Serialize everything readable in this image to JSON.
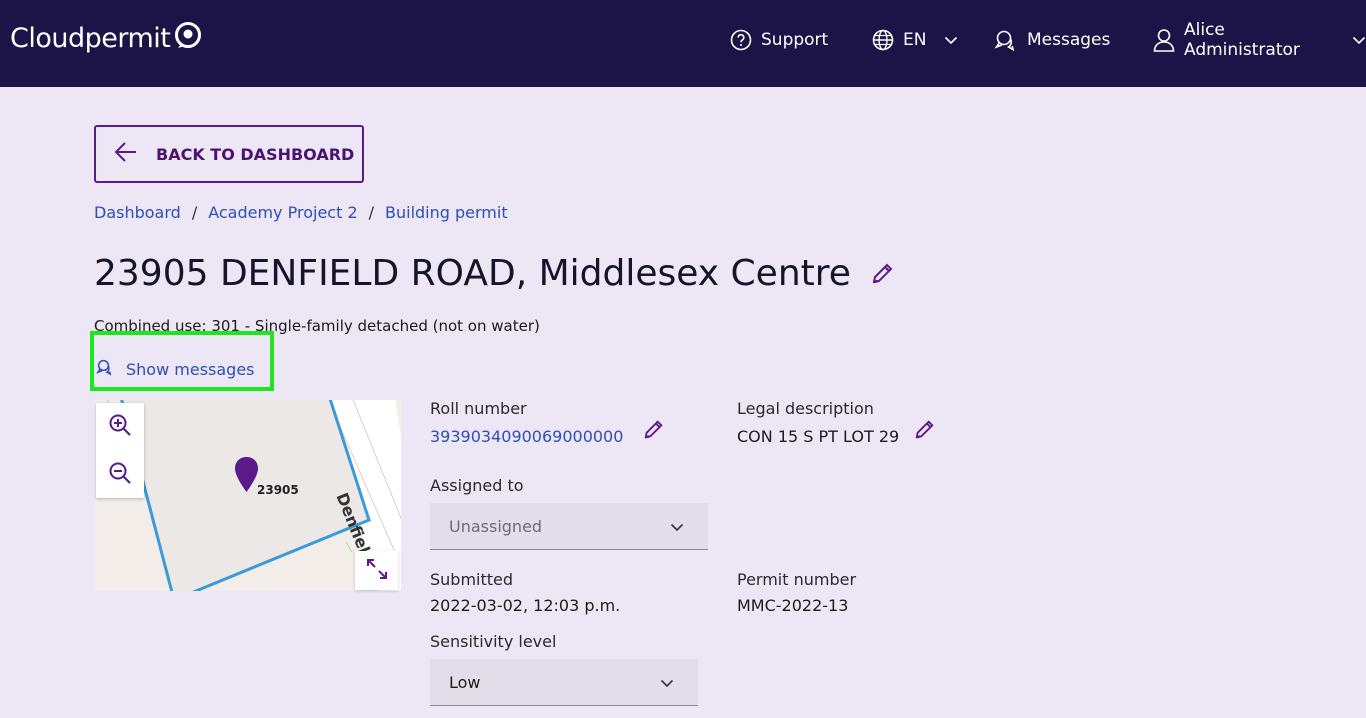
{
  "header": {
    "logo": "Cloudpermit",
    "support": "Support",
    "language": "EN",
    "messages": "Messages",
    "user": "Alice Administrator"
  },
  "back_button": "BACK TO DASHBOARD",
  "breadcrumb": {
    "items": [
      "Dashboard",
      "Academy Project 2",
      "Building permit"
    ],
    "separator": "/"
  },
  "title": "23905 DENFIELD ROAD, Middlesex Centre",
  "subtitle": "Combined use: 301 - Single-family detached (not on water)",
  "show_messages": "Show messages",
  "map": {
    "parcel_label": "23905",
    "road_label": "Denfield"
  },
  "fields": {
    "roll_number_label": "Roll number",
    "roll_number": "3939034090069000000",
    "legal_description_label": "Legal description",
    "legal_description": "CON 15 S PT LOT 29",
    "assigned_to_label": "Assigned to",
    "assigned_to": "Unassigned",
    "submitted_label": "Submitted",
    "submitted": "2022-03-02, 12:03 p.m.",
    "permit_number_label": "Permit number",
    "permit_number": "MMC-2022-13",
    "sensitivity_label": "Sensitivity level",
    "sensitivity": "Low"
  },
  "colors": {
    "topbar": "#1c1446",
    "background": "#ede6f4",
    "accent": "#5a1a8a",
    "link": "#2c4fb8",
    "highlight": "#1ee61e"
  },
  "icons": [
    "logo-icon",
    "help-circle-icon",
    "globe-icon",
    "chevron-down-icon",
    "messages-icon",
    "user-icon",
    "arrow-left-icon",
    "pencil-icon",
    "zoom-in-icon",
    "zoom-out-icon",
    "map-pin-icon",
    "expand-icon"
  ]
}
